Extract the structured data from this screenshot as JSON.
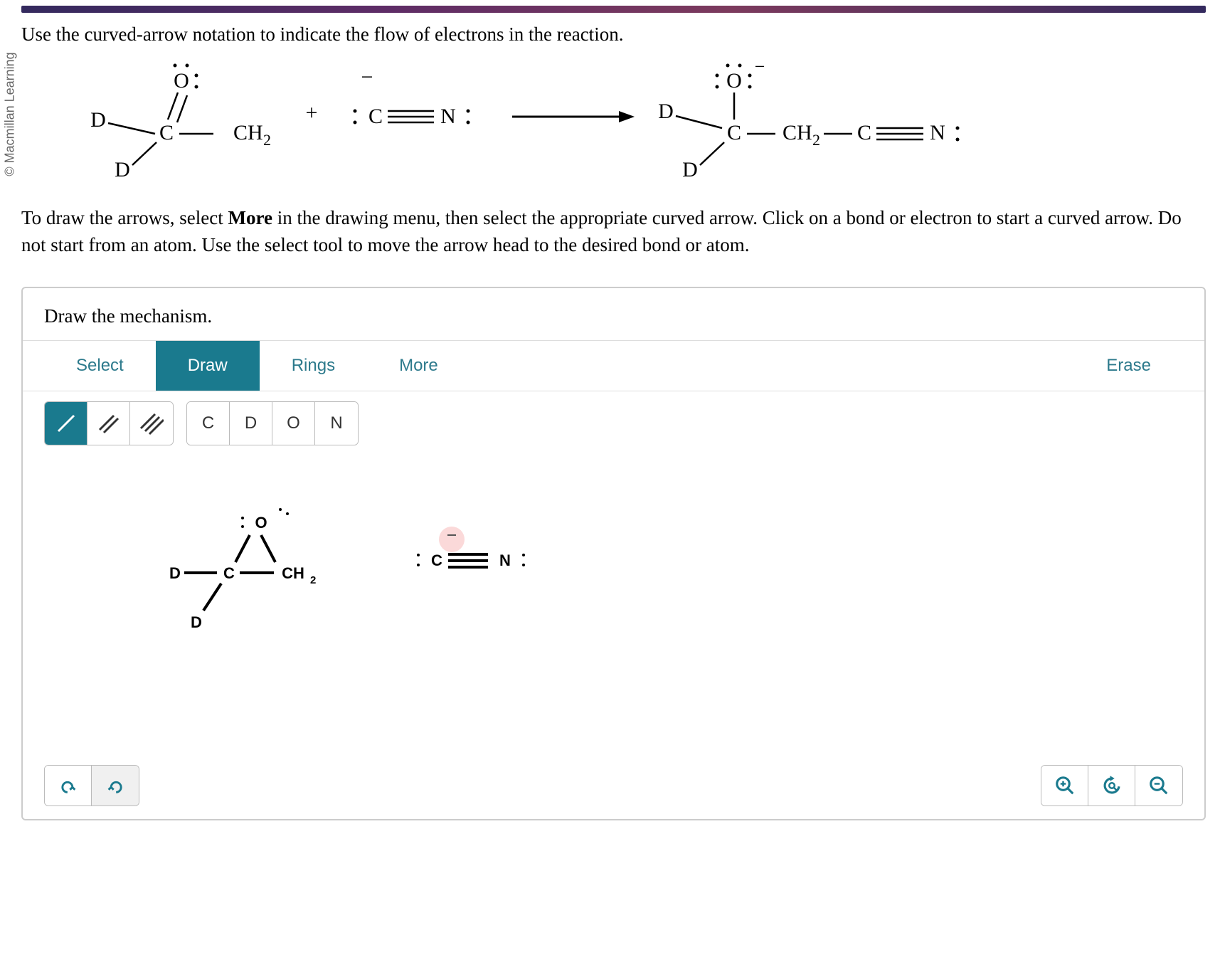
{
  "copyright": "© Macmillan Learning",
  "question": "Use the curved-arrow notation to indicate the flow of electrons in the reaction.",
  "instruction_pre": "To draw the arrows, select ",
  "instruction_bold": "More",
  "instruction_post": " in the drawing menu, then select the appropriate curved arrow. Click on a bond or electron to start a curved arrow. Do not start from an atom. Use the select tool to move the arrow head to the desired bond or atom.",
  "editor": {
    "header": "Draw the mechanism.",
    "tabs": {
      "select": "Select",
      "draw": "Draw",
      "rings": "Rings",
      "more": "More",
      "erase": "Erase"
    },
    "atoms": {
      "c": "C",
      "d": "D",
      "o": "O",
      "n": "N"
    }
  },
  "reaction": {
    "reactant_labels": {
      "O": "O",
      "D1": "D",
      "D2": "D",
      "C": "C",
      "CH2": "CH2"
    },
    "plus": "+",
    "cyanide": {
      "C": "C",
      "N": "N"
    },
    "arrow": "→",
    "product": {
      "O": "O",
      "D1": "D",
      "D2": "D",
      "C": "C",
      "CH2": "CH2",
      "Ccn": "C",
      "N": "N"
    }
  },
  "canvas_molecule": {
    "O": "O",
    "D1": "D",
    "D2": "D",
    "C": "C",
    "CH2": "CH₂",
    "cyanide": {
      "C": "C",
      "N": "N"
    }
  },
  "icons": {
    "undo": "undo",
    "redo": "redo",
    "zoom_in": "zoom-in",
    "reset_zoom": "reset-zoom",
    "zoom_out": "zoom-out"
  }
}
